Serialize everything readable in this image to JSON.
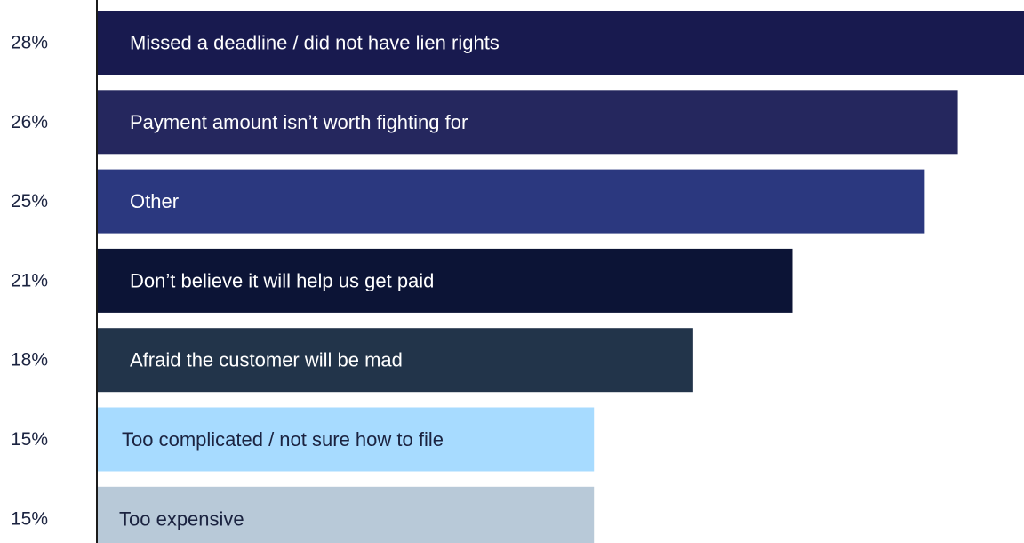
{
  "chart_data": {
    "type": "bar",
    "orientation": "horizontal",
    "title": "",
    "xlabel": "",
    "ylabel": "",
    "xlim": [
      0,
      28
    ],
    "grid": false,
    "legend": "none",
    "categories": [
      "Missed a deadline / did not have lien rights",
      "Payment amount isn’t worth fighting for",
      "Other",
      "Don’t believe it will help us get paid",
      "Afraid the customer will be mad",
      "Too complicated / not sure how to file",
      "Too expensive"
    ],
    "values": [
      28,
      26,
      25,
      21,
      18,
      15,
      15
    ],
    "value_labels": [
      "28%",
      "26%",
      "25%",
      "21%",
      "18%",
      "15%",
      "15%"
    ],
    "bar_colors": [
      "#181a4f",
      "#25275e",
      "#2b387f",
      "#0c1436",
      "#22344a",
      "#a7dbff",
      "#b8c9d8"
    ],
    "label_colors": [
      "#ffffff",
      "#ffffff",
      "#ffffff",
      "#ffffff",
      "#ffffff",
      "#1b2340",
      "#1b2340"
    ]
  }
}
